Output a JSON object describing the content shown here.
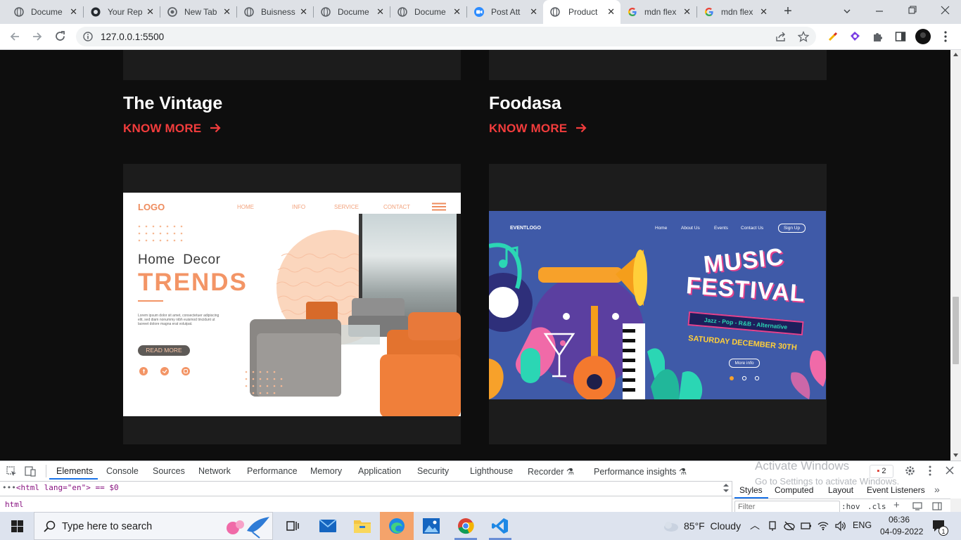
{
  "browser": {
    "tabs": [
      {
        "title": "Docume",
        "icon": "globe-icon"
      },
      {
        "title": "Your Rep",
        "icon": "github-icon"
      },
      {
        "title": "New Tab",
        "icon": "chrome-icon"
      },
      {
        "title": "Buisness",
        "icon": "globe-icon"
      },
      {
        "title": "Docume",
        "icon": "globe-icon"
      },
      {
        "title": "Docume",
        "icon": "globe-icon"
      },
      {
        "title": "Post Att",
        "icon": "zoom-icon"
      },
      {
        "title": "Product",
        "icon": "globe-icon",
        "active": true
      },
      {
        "title": "mdn flex",
        "icon": "google-icon"
      },
      {
        "title": "mdn flex",
        "icon": "google-icon"
      }
    ],
    "url": "127.0.0.1:5500"
  },
  "page": {
    "projects": [
      {
        "title": "The Vintage",
        "link": "KNOW MORE"
      },
      {
        "title": "Foodasa",
        "link": "KNOW MORE"
      }
    ],
    "home_decor": {
      "logo": "LOGO",
      "nav": [
        "HOME",
        "INFO",
        "SERVICE",
        "CONTACT"
      ],
      "line1": "Home  Decor",
      "line2": "TRENDS",
      "body": "Lorem ipsum dolor sit amet, consectetuer adipiscing elit, sed diam nonummy nibh euismod tincidunt ut laoreet dolore magna erat volutpat.",
      "button": "READ MORE"
    },
    "music": {
      "logo": "EVENTLOGO",
      "nav": [
        "Home",
        "About Us",
        "Events",
        "Contact Us"
      ],
      "signup": "Sign Up",
      "title1": "MUSIC",
      "title2": "FESTIVAL",
      "genres": "Jazz - Pop - R&B - Alternative",
      "date": "SATURDAY DECEMBER 30TH",
      "more": "More info"
    }
  },
  "devtools": {
    "tabs": [
      "Elements",
      "Console",
      "Sources",
      "Network",
      "Performance",
      "Memory",
      "Application",
      "Security",
      "Lighthouse",
      "Recorder",
      "Performance insights"
    ],
    "dom_line": "<html lang=\"en\"> == $0",
    "breadcrumb": "html",
    "issues": "2",
    "right_tabs": [
      "Styles",
      "Computed",
      "Layout",
      "Event Listeners"
    ],
    "filter_placeholder": "Filter",
    "hov": ":hov",
    "cls": ".cls",
    "watermark1": "Activate Windows",
    "watermark2": "Go to Settings to activate Windows."
  },
  "taskbar": {
    "search_placeholder": "Type here to search",
    "weather": "85°F  Cloudy",
    "lang": "ENG",
    "time": "06:36",
    "date": "04-09-2022",
    "notifications": "1"
  },
  "colors": {
    "accent": "#f23c3c",
    "page_bg": "#0e0e0e",
    "card_bg": "#1c1c1c",
    "music_bg": "#3f5aa8"
  }
}
